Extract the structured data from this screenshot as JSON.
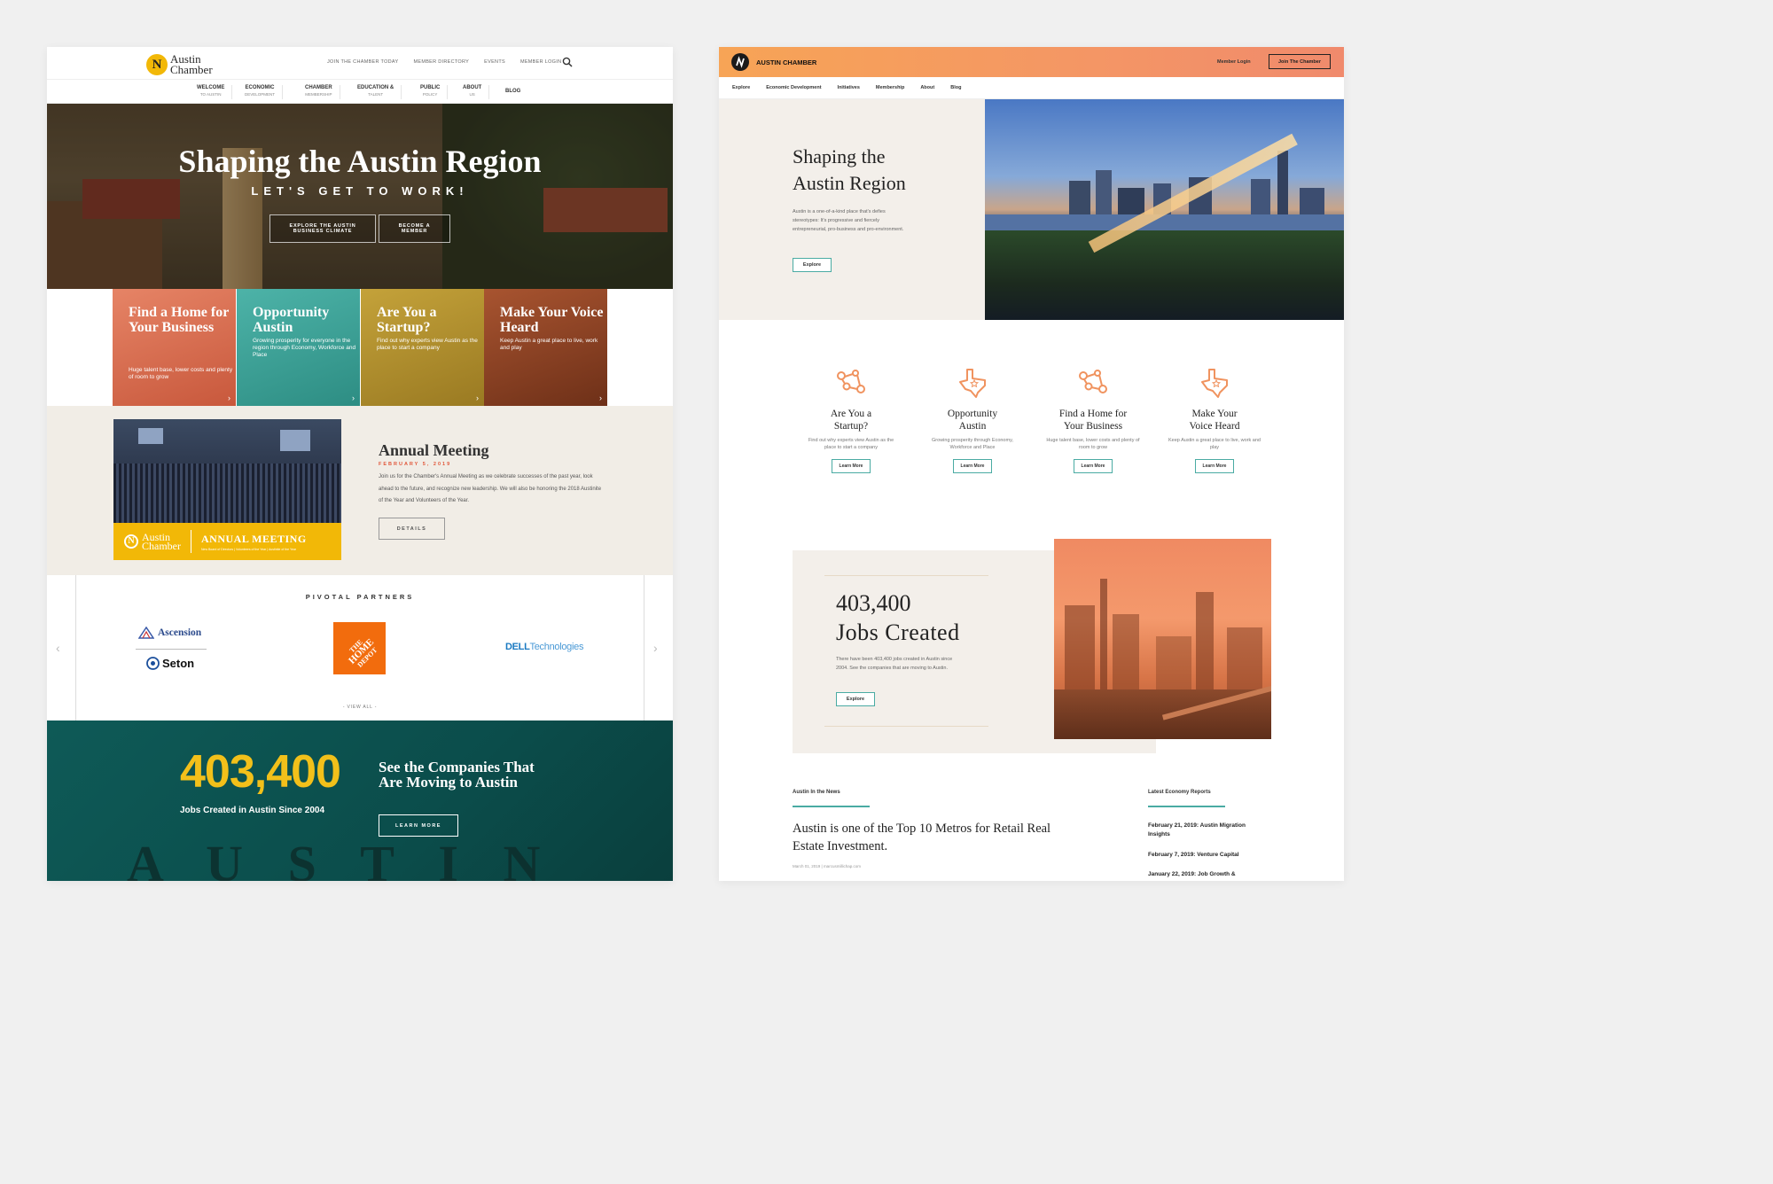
{
  "left": {
    "logo": {
      "line1": "Austin",
      "line2": "Chamber",
      "mark": "N"
    },
    "utility_nav": [
      "JOIN THE CHAMBER TODAY",
      "MEMBER DIRECTORY",
      "EVENTS",
      "MEMBER LOGIN"
    ],
    "main_nav": [
      {
        "label": "WELCOME",
        "sub": "TO AUSTIN"
      },
      {
        "label": "ECONOMIC",
        "sub": "DEVELOPMENT"
      },
      {
        "label": "CHAMBER",
        "sub": "MEMBERSHIP"
      },
      {
        "label": "EDUCATION &",
        "sub": "TALENT"
      },
      {
        "label": "PUBLIC",
        "sub": "POLICY"
      },
      {
        "label": "ABOUT",
        "sub": "US"
      },
      {
        "label": "BLOG",
        "sub": ""
      }
    ],
    "hero": {
      "title": "Shaping the Austin Region",
      "tagline": "LET'S GET TO WORK!",
      "btn1_line1": "EXPLORE THE AUSTIN",
      "btn1_line2": "BUSINESS CLIMATE",
      "btn2_line1": "BECOME A",
      "btn2_line2": "MEMBER"
    },
    "cards": [
      {
        "title": "Find a Home for Your Business",
        "text": "Huge talent base, lower costs and plenty of room to grow",
        "color": "#e07a5c"
      },
      {
        "title": "Opportunity Austin",
        "text": "Growing prosperity for everyone in the region through Economy, Workforce and Place",
        "color": "#3fa79c"
      },
      {
        "title": "Are You a Startup?",
        "text": "Find out why experts view Austin as the place to start a company",
        "color": "#b3922d"
      },
      {
        "title": "Make Your Voice Heard",
        "text": "Keep Austin a great place to live, work and play",
        "color": "#9a4a2a"
      }
    ],
    "annual_meeting": {
      "title": "Annual Meeting",
      "date": "FEBRUARY 5, 2019",
      "body": "Join us for the Chamber's Annual Meeting as we celebrate successes of the past year, look ahead to the future, and recognize new leadership. We will also be honoring the 2018 Austinite of the Year and Volunteers of the Year.",
      "button": "DETAILS",
      "banner_logo1": "Austin",
      "banner_logo2": "Chamber",
      "banner_title": "ANNUAL MEETING",
      "banner_sub": "New Board of Directors  |  Volunteers of the Year  |  Austinite of the Year"
    },
    "partners": {
      "heading": "PIVOTAL PARTNERS",
      "ascension": "Ascension",
      "seton": "Seton",
      "homedepot_line1": "THE",
      "homedepot_line2": "HOME",
      "homedepot_line3": "DEPOT",
      "dell_a": "DELL",
      "dell_b": "Technologies",
      "view_all": "- VIEW ALL -",
      "prev": "‹",
      "next": "›"
    },
    "stats": {
      "number": "403,400",
      "caption": "Jobs Created in Austin Since 2004",
      "headline": "See the Companies That Are Moving to Austin",
      "button": "LEARN MORE",
      "sign": "A U S T I N"
    }
  },
  "right": {
    "brand": "AUSTIN CHAMBER",
    "member_login": "Member Login",
    "join": "Join The Chamber",
    "nav": [
      "Explore",
      "Economic Development",
      "Initiatives",
      "Membership",
      "About",
      "Blog"
    ],
    "hero": {
      "title_line1": "Shaping the",
      "title_line2": "Austin Region",
      "body": "Austin is a one-of-a-kind place that's defies stereotypes: It's progressive and fiercely entrepreneurial, pro-business and pro-environment.",
      "button": "Explore"
    },
    "features": [
      {
        "title_line1": "Are You a",
        "title_line2": "Startup?",
        "text": "Find out why experts view Austin as the place to start a company",
        "button": "Learn More",
        "icon": "network-icon"
      },
      {
        "title_line1": "Opportunity",
        "title_line2": "Austin",
        "text": "Growing prosperity through Economy, Workforce and Place",
        "button": "Learn More",
        "icon": "texas-icon"
      },
      {
        "title_line1": "Find a Home for",
        "title_line2": "Your Business",
        "text": "Huge talent base, lower costs and plenty of room to grow",
        "button": "Learn More",
        "icon": "network-icon"
      },
      {
        "title_line1": "Make Your",
        "title_line2": "Voice Heard",
        "text": "Keep Austin a great place to live, work and play",
        "button": "Learn More",
        "icon": "texas-icon"
      }
    ],
    "jobs": {
      "number": "403,400",
      "label": "Jobs Created",
      "body": "There have been 403,400 jobs created in Austin since 2004. See the companies that are moving to Austin.",
      "button": "Explore"
    },
    "news": {
      "heading": "Austin In the News",
      "headline": "Austin is one of the Top 10 Metros for Retail Real Estate Investment.",
      "meta": "March 01, 2019  |  marcusmillichap.com"
    },
    "reports": {
      "heading": "Latest Economy Reports",
      "items": [
        "February 21, 2019: Austin Migration Insights",
        "February 7, 2019: Venture Capital",
        "January 22, 2019: Job Growth &"
      ]
    }
  },
  "colors": {
    "accent_yellow": "#f2b807",
    "teal": "#0e5a57",
    "orange_gradient_start": "#f7a456",
    "orange_gradient_end": "#f08a6c",
    "teal_outline": "#4aaba3"
  }
}
